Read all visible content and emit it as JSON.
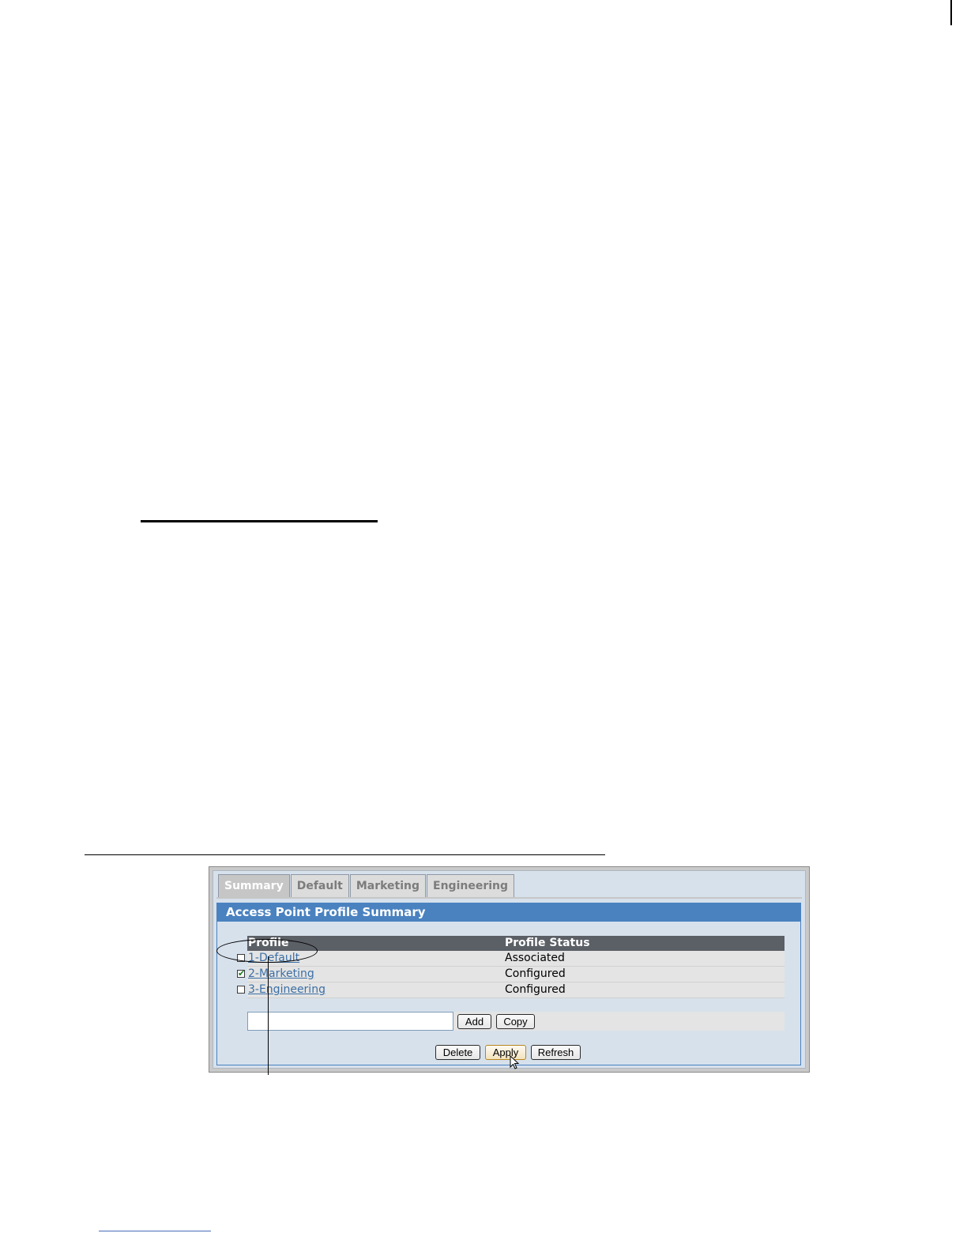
{
  "tabs": [
    {
      "label": "Summary",
      "active": true
    },
    {
      "label": "Default",
      "active": false
    },
    {
      "label": "Marketing",
      "active": false
    },
    {
      "label": "Engineering",
      "active": false
    }
  ],
  "panel": {
    "title": "Access Point Profile Summary"
  },
  "table": {
    "headers": {
      "profile": "Profile",
      "status": "Profile Status"
    },
    "rows": [
      {
        "profile": "1-Default",
        "status": "Associated",
        "checked": false
      },
      {
        "profile": "2-Marketing",
        "status": "Configured",
        "checked": true
      },
      {
        "profile": "3-Engineering",
        "status": "Configured",
        "checked": false
      }
    ]
  },
  "add_row": {
    "input_value": "",
    "add_label": "Add",
    "copy_label": "Copy"
  },
  "actions": {
    "delete_label": "Delete",
    "apply_label": "Apply",
    "refresh_label": "Refresh"
  },
  "colors": {
    "panel_header": "#4a82c0",
    "table_header": "#5b5f66",
    "link": "#3c6fa5"
  }
}
